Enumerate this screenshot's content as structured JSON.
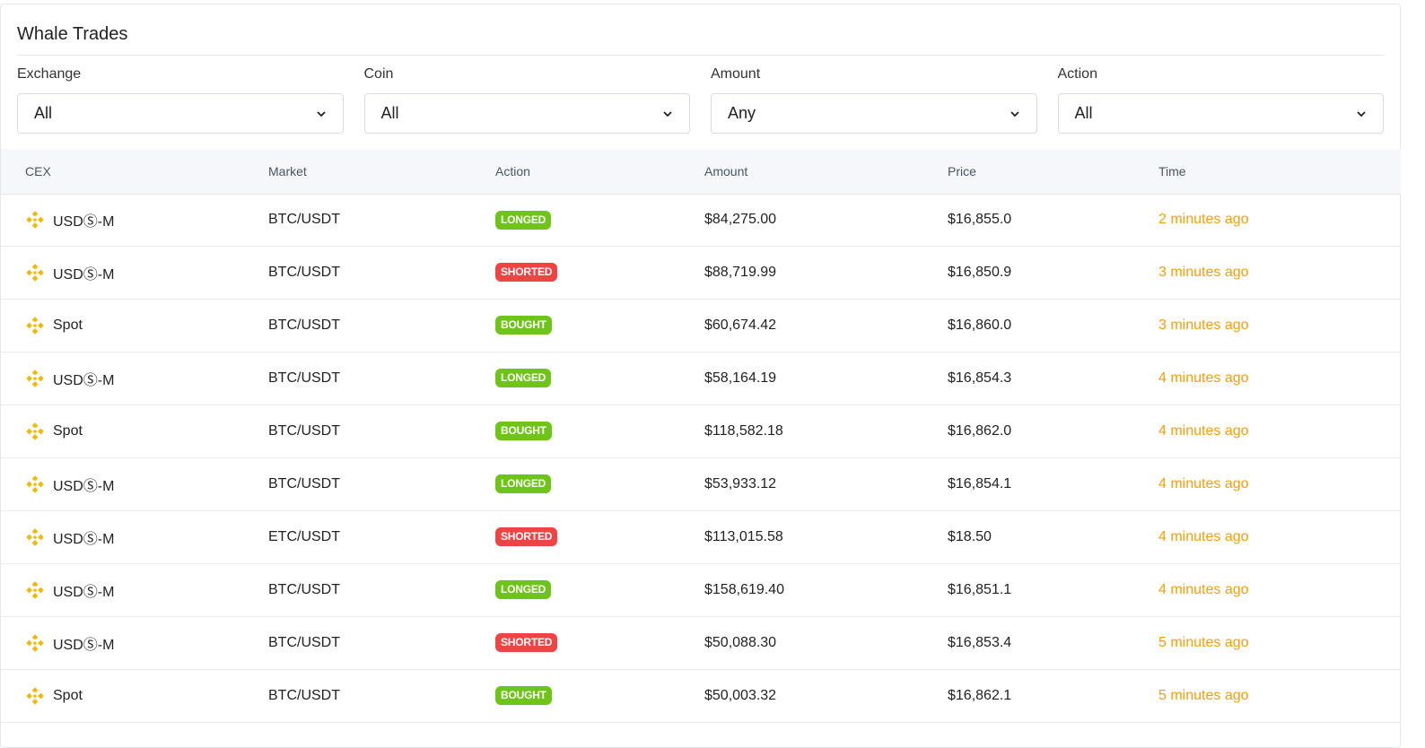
{
  "title": "Whale Trades",
  "filters": [
    {
      "label": "Exchange",
      "value": "All"
    },
    {
      "label": "Coin",
      "value": "All"
    },
    {
      "label": "Amount",
      "value": "Any"
    },
    {
      "label": "Action",
      "value": "All"
    }
  ],
  "columns": [
    "CEX",
    "Market",
    "Action",
    "Amount",
    "Price",
    "Time"
  ],
  "rows": [
    {
      "cex": "USDⓈ-M",
      "market": "BTC/USDT",
      "action": "LONGED",
      "amount": "$84,275.00",
      "price": "$16,855.0",
      "time": "2 minutes ago"
    },
    {
      "cex": "USDⓈ-M",
      "market": "BTC/USDT",
      "action": "SHORTED",
      "amount": "$88,719.99",
      "price": "$16,850.9",
      "time": "3 minutes ago"
    },
    {
      "cex": "Spot",
      "market": "BTC/USDT",
      "action": "BOUGHT",
      "amount": "$60,674.42",
      "price": "$16,860.0",
      "time": "3 minutes ago"
    },
    {
      "cex": "USDⓈ-M",
      "market": "BTC/USDT",
      "action": "LONGED",
      "amount": "$58,164.19",
      "price": "$16,854.3",
      "time": "4 minutes ago"
    },
    {
      "cex": "Spot",
      "market": "BTC/USDT",
      "action": "BOUGHT",
      "amount": "$118,582.18",
      "price": "$16,862.0",
      "time": "4 minutes ago"
    },
    {
      "cex": "USDⓈ-M",
      "market": "BTC/USDT",
      "action": "LONGED",
      "amount": "$53,933.12",
      "price": "$16,854.1",
      "time": "4 minutes ago"
    },
    {
      "cex": "USDⓈ-M",
      "market": "ETC/USDT",
      "action": "SHORTED",
      "amount": "$113,015.58",
      "price": "$18.50",
      "time": "4 minutes ago"
    },
    {
      "cex": "USDⓈ-M",
      "market": "BTC/USDT",
      "action": "LONGED",
      "amount": "$158,619.40",
      "price": "$16,851.1",
      "time": "4 minutes ago"
    },
    {
      "cex": "USDⓈ-M",
      "market": "BTC/USDT",
      "action": "SHORTED",
      "amount": "$50,088.30",
      "price": "$16,853.4",
      "time": "5 minutes ago"
    },
    {
      "cex": "Spot",
      "market": "BTC/USDT",
      "action": "BOUGHT",
      "amount": "$50,003.32",
      "price": "$16,862.1",
      "time": "5 minutes ago"
    }
  ],
  "icons": {
    "exchange": "binance-logo-icon",
    "dropdown": "chevron-down-icon"
  },
  "colors": {
    "positive": "#6ec418",
    "negative": "#ef4444",
    "time": "#f59e0b",
    "brand": "#f0b90b"
  }
}
